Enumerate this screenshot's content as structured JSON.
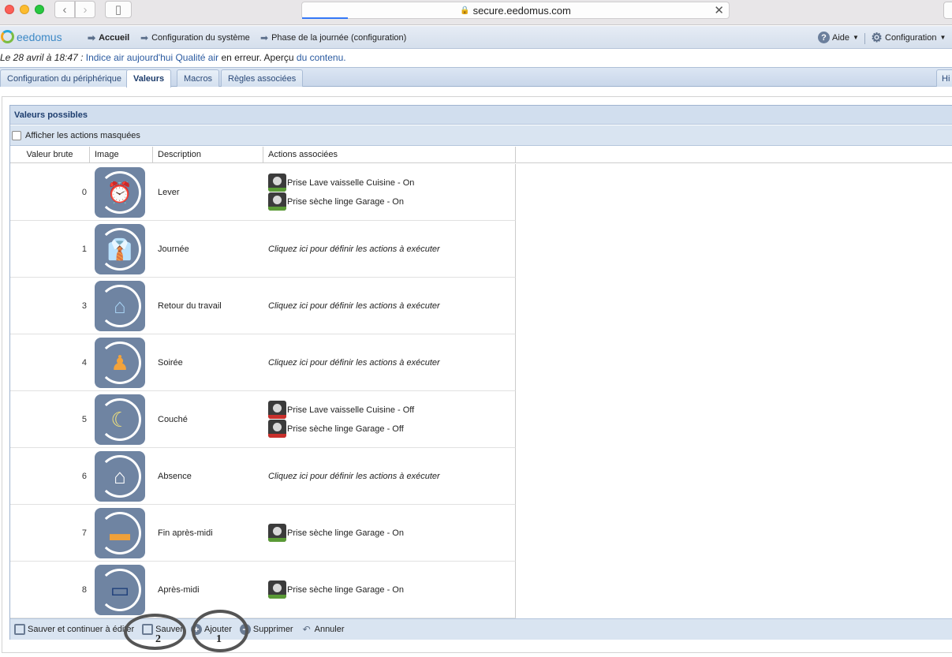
{
  "browser": {
    "url": "secure.eedomus.com"
  },
  "nav": {
    "logo": "eedomus",
    "crumbs": [
      "Accueil",
      "Configuration du système",
      "Phase de la journée (configuration)"
    ],
    "help": "Aide",
    "config": "Configuration"
  },
  "notice": {
    "prefix": "Le 28 avril à 18:47 :",
    "link1": "Indice air aujourd'hui Qualité air",
    "middle": "en erreur. Aperçu",
    "link2": "du contenu."
  },
  "tabs": [
    "Configuration du périphérique",
    "Valeurs",
    "Macros",
    "Règles associées",
    "Hi"
  ],
  "panel": {
    "title": "Valeurs possibles",
    "show_hidden": "Afficher les actions masquées",
    "columns": [
      "Valeur brute",
      "Image",
      "Description",
      "Actions associées"
    ]
  },
  "placeholder": "Cliquez ici pour définir les actions à exécuter",
  "rows": [
    {
      "value": "0",
      "desc": "Lever",
      "icon": "alarm-clock-icon",
      "glyph": "⏰",
      "actions": [
        "Prise Lave vaisselle Cuisine - On",
        "Prise sèche linge Garage - On"
      ]
    },
    {
      "value": "1",
      "desc": "Journée",
      "icon": "tie-icon",
      "glyph": "👔",
      "actions": []
    },
    {
      "value": "3",
      "desc": "Retour du travail",
      "icon": "house-icon",
      "glyph": "⌂",
      "actions": []
    },
    {
      "value": "4",
      "desc": "Soirée",
      "icon": "lamp-icon",
      "glyph": "♟",
      "actions": []
    },
    {
      "value": "5",
      "desc": "Couché",
      "icon": "moon-icon",
      "glyph": "☾",
      "actions": [
        "Prise Lave vaisselle Cuisine - Off",
        "Prise sèche linge Garage - Off"
      ]
    },
    {
      "value": "6",
      "desc": "Absence",
      "icon": "house-lock-icon",
      "glyph": "⌂",
      "actions": []
    },
    {
      "value": "7",
      "desc": "Fin après-midi",
      "icon": "sofa-icon",
      "glyph": "▬",
      "actions": [
        "Prise sèche linge Garage - On"
      ]
    },
    {
      "value": "8",
      "desc": "Après-midi",
      "icon": "tv-icon",
      "glyph": "▭",
      "actions": [
        "Prise sèche linge Garage - On"
      ]
    }
  ],
  "footer": {
    "save_continue": "Sauver et continuer à éditer",
    "save": "Sauver",
    "add": "Ajouter",
    "delete": "Supprimer",
    "cancel": "Annuler"
  },
  "annotations": [
    "1",
    "2"
  ]
}
